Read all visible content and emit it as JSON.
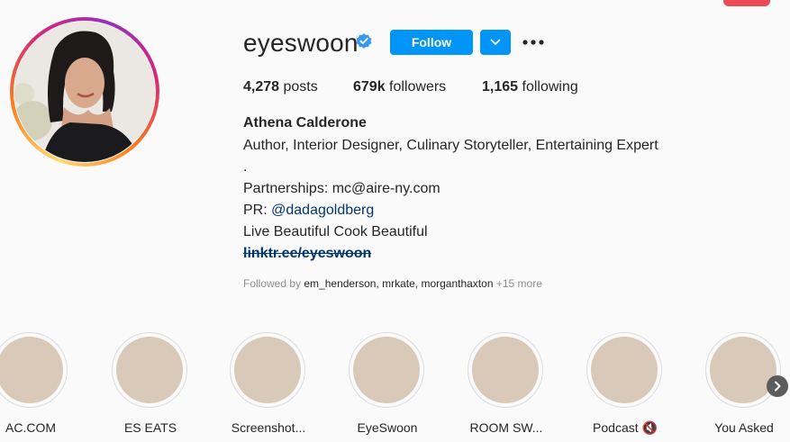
{
  "profile": {
    "username": "eyeswoon",
    "verified": true,
    "follow_label": "Follow",
    "accent_color": "#0095f6",
    "icons": {
      "verified": "verified-badge-icon",
      "dropdown": "chevron-down-icon",
      "more": "more-options-icon"
    }
  },
  "stats": {
    "posts_count": "4,278",
    "posts_label": "posts",
    "followers_count": "679k",
    "followers_label": "followers",
    "following_count": "1,165",
    "following_label": "following"
  },
  "bio": {
    "name": "Athena Calderone",
    "line1": "Author, Interior Designer, Culinary Storyteller, Entertaining Expert",
    "line2": ".",
    "line3": "Partnerships: mc@aire-ny.com",
    "pr_prefix": "PR: ",
    "pr_handle": "@dadagoldberg",
    "line5": "Live Beautiful Cook Beautiful",
    "link": "linktr.ee/eyeswoon"
  },
  "followed_by": {
    "prefix": "Followed by ",
    "names": "em_henderson, mrkate, morganthaxton",
    "more": " +15 more"
  },
  "highlights": [
    {
      "label": "AC.COM"
    },
    {
      "label": "ES EATS"
    },
    {
      "label": "Screenshot..."
    },
    {
      "label": "EyeSwoon"
    },
    {
      "label": "ROOM SW..."
    },
    {
      "label": "Podcast 🔇"
    },
    {
      "label": "You Asked"
    }
  ]
}
